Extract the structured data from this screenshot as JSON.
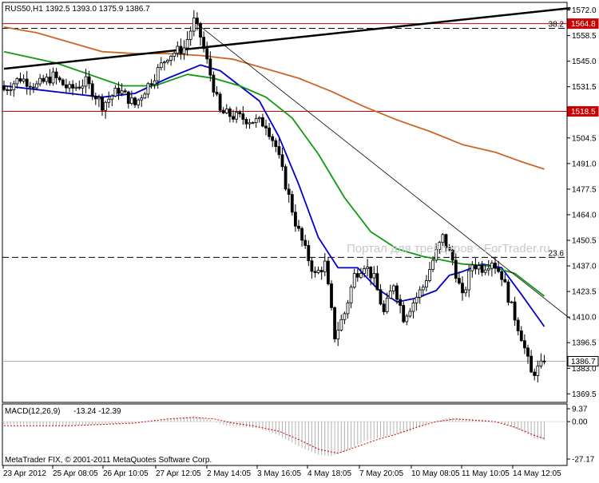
{
  "window": {
    "symbol_label": "RUS50,H1",
    "ohlc_label": "1392.5 1393.0 1375.9 1386.7",
    "copyright": "MetaTrader FIX, © 2001-2011 MetaQuotes Software Corp.",
    "watermark": "Портал для трейдеров - ForTrader.ru"
  },
  "colors": {
    "background": "#ffffff",
    "candle": "#000000",
    "ma_fast": "#0000cc",
    "ma_mid": "#119911",
    "ma_slow": "#cc6622",
    "support_line": "#cc0000",
    "trendline": "#000000",
    "macd_hist": "#b0b0b0",
    "macd_signal": "#cc0000",
    "price_badge": "#cc0000"
  },
  "chart_data": [
    {
      "type": "candlestick",
      "title": "RUS50,H1",
      "ylim": [
        1365,
        1576
      ],
      "y_ticks": [
        "1572.0",
        "1558.5",
        "1545.0",
        "1531.5",
        "1504.5",
        "1491.0",
        "1477.5",
        "1464.0",
        "1450.5",
        "1437.0",
        "1423.5",
        "1410.0",
        "1396.5",
        "1383.0",
        "1369.5"
      ],
      "x_ticks": [
        "23 Apr 2012",
        "25 Apr 08:05",
        "26 Apr 10:05",
        "27 Apr 12:05",
        "2 May 14:05",
        "3 May 16:05",
        "4 May 18:05",
        "7 May 20:05",
        "10 May 08:05",
        "11 May 10:05",
        "14 May 12:05"
      ],
      "close_anchors": [
        {
          "bar": 0,
          "close": 1530
        },
        {
          "bar": 5,
          "close": 1536
        },
        {
          "bar": 10,
          "close": 1532
        },
        {
          "bar": 15,
          "close": 1537
        },
        {
          "bar": 20,
          "close": 1530
        },
        {
          "bar": 25,
          "close": 1534
        },
        {
          "bar": 30,
          "close": 1522
        },
        {
          "bar": 35,
          "close": 1530
        },
        {
          "bar": 40,
          "close": 1522
        },
        {
          "bar": 45,
          "close": 1535
        },
        {
          "bar": 50,
          "close": 1548
        },
        {
          "bar": 55,
          "close": 1552
        },
        {
          "bar": 58,
          "close": 1566
        },
        {
          "bar": 60,
          "close": 1558
        },
        {
          "bar": 63,
          "close": 1538
        },
        {
          "bar": 66,
          "close": 1518
        },
        {
          "bar": 70,
          "close": 1516
        },
        {
          "bar": 75,
          "close": 1514
        },
        {
          "bar": 80,
          "close": 1512
        },
        {
          "bar": 83,
          "close": 1500
        },
        {
          "bar": 86,
          "close": 1480
        },
        {
          "bar": 89,
          "close": 1460
        },
        {
          "bar": 92,
          "close": 1445
        },
        {
          "bar": 95,
          "close": 1432
        },
        {
          "bar": 98,
          "close": 1438
        },
        {
          "bar": 101,
          "close": 1400
        },
        {
          "bar": 104,
          "close": 1412
        },
        {
          "bar": 107,
          "close": 1432
        },
        {
          "bar": 110,
          "close": 1438
        },
        {
          "bar": 113,
          "close": 1430
        },
        {
          "bar": 116,
          "close": 1412
        },
        {
          "bar": 119,
          "close": 1428
        },
        {
          "bar": 122,
          "close": 1410
        },
        {
          "bar": 125,
          "close": 1418
        },
        {
          "bar": 128,
          "close": 1426
        },
        {
          "bar": 131,
          "close": 1440
        },
        {
          "bar": 134,
          "close": 1452
        },
        {
          "bar": 137,
          "close": 1440
        },
        {
          "bar": 140,
          "close": 1420
        },
        {
          "bar": 143,
          "close": 1438
        },
        {
          "bar": 146,
          "close": 1436
        },
        {
          "bar": 149,
          "close": 1440
        },
        {
          "bar": 152,
          "close": 1432
        },
        {
          "bar": 155,
          "close": 1415
        },
        {
          "bar": 158,
          "close": 1400
        },
        {
          "bar": 161,
          "close": 1380
        },
        {
          "bar": 164,
          "close": 1384
        },
        {
          "bar": 165,
          "close": 1386.7
        }
      ],
      "moving_averages": [
        {
          "color": "#0000cc",
          "points": [
            [
              0,
              1532
            ],
            [
              10,
              1530
            ],
            [
              20,
              1528
            ],
            [
              30,
              1526
            ],
            [
              40,
              1528
            ],
            [
              50,
              1536
            ],
            [
              60,
              1543
            ],
            [
              66,
              1540
            ],
            [
              72,
              1532
            ],
            [
              78,
              1524
            ],
            [
              84,
              1505
            ],
            [
              90,
              1480
            ],
            [
              96,
              1452
            ],
            [
              102,
              1436
            ],
            [
              108,
              1436
            ],
            [
              114,
              1425
            ],
            [
              120,
              1418
            ],
            [
              126,
              1420
            ],
            [
              132,
              1424
            ],
            [
              136,
              1432
            ],
            [
              140,
              1434
            ],
            [
              146,
              1438
            ],
            [
              152,
              1436
            ],
            [
              158,
              1422
            ],
            [
              165,
              1405
            ]
          ]
        },
        {
          "color": "#119911",
          "points": [
            [
              0,
              1550
            ],
            [
              8,
              1547
            ],
            [
              16,
              1544
            ],
            [
              26,
              1538
            ],
            [
              36,
              1532
            ],
            [
              46,
              1532
            ],
            [
              56,
              1538
            ],
            [
              64,
              1536
            ],
            [
              72,
              1532
            ],
            [
              80,
              1526
            ],
            [
              88,
              1515
            ],
            [
              96,
              1496
            ],
            [
              104,
              1473
            ],
            [
              112,
              1455
            ],
            [
              120,
              1446
            ],
            [
              128,
              1442
            ],
            [
              134,
              1440
            ],
            [
              140,
              1438
            ],
            [
              148,
              1437
            ],
            [
              156,
              1433
            ],
            [
              165,
              1421
            ]
          ]
        },
        {
          "color": "#cc6622",
          "points": [
            [
              0,
              1563
            ],
            [
              10,
              1560
            ],
            [
              20,
              1555
            ],
            [
              30,
              1550
            ],
            [
              40,
              1549
            ],
            [
              50,
              1549
            ],
            [
              60,
              1548
            ],
            [
              70,
              1546
            ],
            [
              80,
              1541
            ],
            [
              90,
              1536
            ],
            [
              100,
              1529
            ],
            [
              110,
              1521
            ],
            [
              120,
              1514
            ],
            [
              130,
              1508
            ],
            [
              140,
              1501
            ],
            [
              150,
              1497
            ],
            [
              158,
              1492
            ],
            [
              165,
              1488
            ]
          ]
        }
      ],
      "horizontal_levels": [
        {
          "value": 1564.8,
          "label": "1564.8",
          "style": "solid-red",
          "badge": true
        },
        {
          "value": 1562.3,
          "label": "38.2",
          "style": "dashed-black",
          "badge": false
        },
        {
          "value": 1518.5,
          "label": "1518.5",
          "style": "solid-red",
          "badge": true
        },
        {
          "value": 1441.5,
          "label": "23.6",
          "style": "dashed-black",
          "badge": false
        },
        {
          "value": 1386.7,
          "label": "1386.7",
          "style": "solid-gray",
          "badge": true
        }
      ],
      "trendlines": [
        {
          "from": [
            0,
            1541
          ],
          "to": [
            173,
            1573
          ],
          "width": 2.5
        },
        {
          "from": [
            58,
            1566
          ],
          "to": [
            173,
            1409
          ],
          "width": 0.8
        }
      ]
    },
    {
      "type": "histogram",
      "title": "MACD(12,26,9)",
      "params": "-13.24 -12.39",
      "ylim": [
        -27.17,
        9.37
      ],
      "y_ticks": [
        "9.37",
        "0.00",
        "-27.17"
      ],
      "hist_anchors": [
        {
          "bar": 0,
          "v": -2
        },
        {
          "bar": 10,
          "v": -2
        },
        {
          "bar": 20,
          "v": -3
        },
        {
          "bar": 30,
          "v": -2
        },
        {
          "bar": 40,
          "v": -1
        },
        {
          "bar": 50,
          "v": 2
        },
        {
          "bar": 58,
          "v": 4
        },
        {
          "bar": 62,
          "v": 2
        },
        {
          "bar": 68,
          "v": -3
        },
        {
          "bar": 74,
          "v": -4
        },
        {
          "bar": 78,
          "v": -5
        },
        {
          "bar": 84,
          "v": -10
        },
        {
          "bar": 90,
          "v": -18
        },
        {
          "bar": 96,
          "v": -24
        },
        {
          "bar": 100,
          "v": -25
        },
        {
          "bar": 104,
          "v": -22
        },
        {
          "bar": 110,
          "v": -14
        },
        {
          "bar": 118,
          "v": -10
        },
        {
          "bar": 124,
          "v": -7
        },
        {
          "bar": 130,
          "v": -1
        },
        {
          "bar": 136,
          "v": 3
        },
        {
          "bar": 142,
          "v": 2
        },
        {
          "bar": 148,
          "v": 1
        },
        {
          "bar": 154,
          "v": -3
        },
        {
          "bar": 158,
          "v": -7
        },
        {
          "bar": 162,
          "v": -12
        },
        {
          "bar": 165,
          "v": -13.24
        }
      ],
      "signal_anchors": [
        {
          "bar": 0,
          "v": -3
        },
        {
          "bar": 10,
          "v": -3
        },
        {
          "bar": 20,
          "v": -3
        },
        {
          "bar": 30,
          "v": -2
        },
        {
          "bar": 40,
          "v": -1
        },
        {
          "bar": 50,
          "v": 2
        },
        {
          "bar": 58,
          "v": 3
        },
        {
          "bar": 64,
          "v": 2
        },
        {
          "bar": 70,
          "v": -1
        },
        {
          "bar": 76,
          "v": -3
        },
        {
          "bar": 84,
          "v": -7
        },
        {
          "bar": 90,
          "v": -13
        },
        {
          "bar": 96,
          "v": -20
        },
        {
          "bar": 102,
          "v": -23
        },
        {
          "bar": 108,
          "v": -18
        },
        {
          "bar": 114,
          "v": -13
        },
        {
          "bar": 120,
          "v": -9
        },
        {
          "bar": 126,
          "v": -4
        },
        {
          "bar": 132,
          "v": 0
        },
        {
          "bar": 138,
          "v": 2
        },
        {
          "bar": 144,
          "v": 1
        },
        {
          "bar": 150,
          "v": 0
        },
        {
          "bar": 156,
          "v": -4
        },
        {
          "bar": 162,
          "v": -10
        },
        {
          "bar": 165,
          "v": -12.39
        }
      ]
    }
  ]
}
